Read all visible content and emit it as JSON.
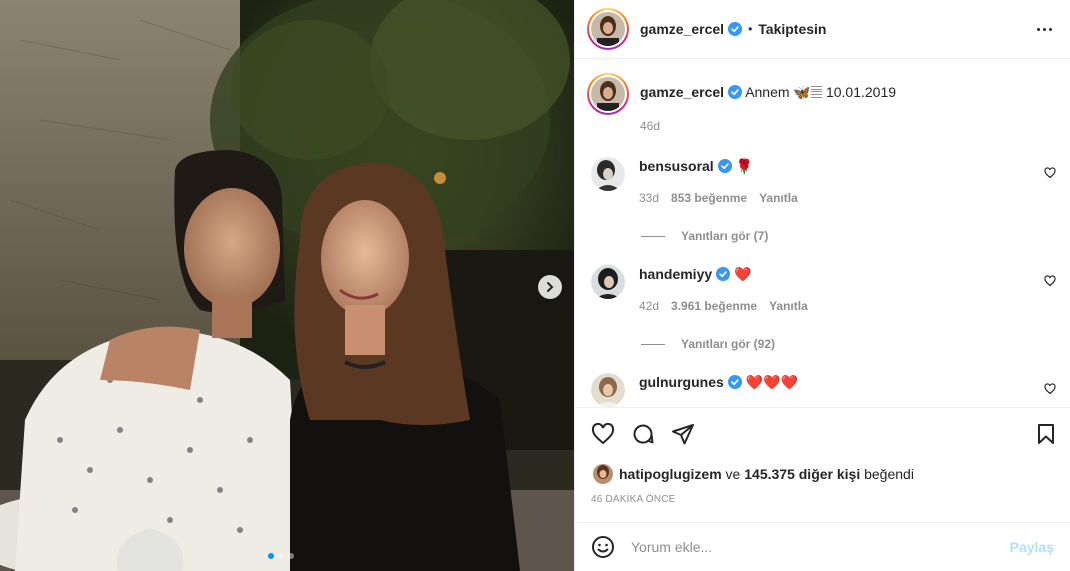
{
  "header": {
    "username": "gamze_ercel",
    "separator": "•",
    "follow_label": "Takiptesin"
  },
  "caption": {
    "username": "gamze_ercel",
    "text": "Annem 🦋𝄚 10.01.2019",
    "time": "46d"
  },
  "comments": [
    {
      "username": "bensusoral",
      "text": "🌹",
      "time": "33d",
      "likes": "853 beğenme",
      "reply_label": "Yanıtla",
      "view_replies": "Yanıtları gör (7)"
    },
    {
      "username": "handemiyy",
      "text": "❤️",
      "time": "42d",
      "likes": "3.961 beğenme",
      "reply_label": "Yanıtla",
      "view_replies": "Yanıtları gör (92)"
    },
    {
      "username": "gulnurgunes",
      "text": "❤️❤️❤️",
      "time": "",
      "likes": "",
      "reply_label": "",
      "view_replies": ""
    }
  ],
  "likes": {
    "user": "hatipoglugizem",
    "middle": " ve ",
    "count": "145.375 diğer kişi",
    "suffix": " beğendi"
  },
  "time_ago": "46 DAKİKA ÖNCE",
  "add_comment": {
    "placeholder": "Yorum ekle...",
    "post_label": "Paylaş"
  },
  "carousel": {
    "dot_count": 3,
    "active_index": 0
  },
  "icons": {
    "verified": "verified-badge-icon",
    "more": "more-options-icon",
    "like": "heart-icon",
    "comment": "comment-bubble-icon",
    "share": "paper-plane-icon",
    "save": "bookmark-icon",
    "emoji": "emoji-smile-icon",
    "next": "chevron-right-icon"
  },
  "colors": {
    "verified": "#3897f0",
    "link_disabled": "#b2dffc",
    "active_dot": "#0095f6",
    "ring_start": "#feda75",
    "ring_end": "#d62976"
  }
}
